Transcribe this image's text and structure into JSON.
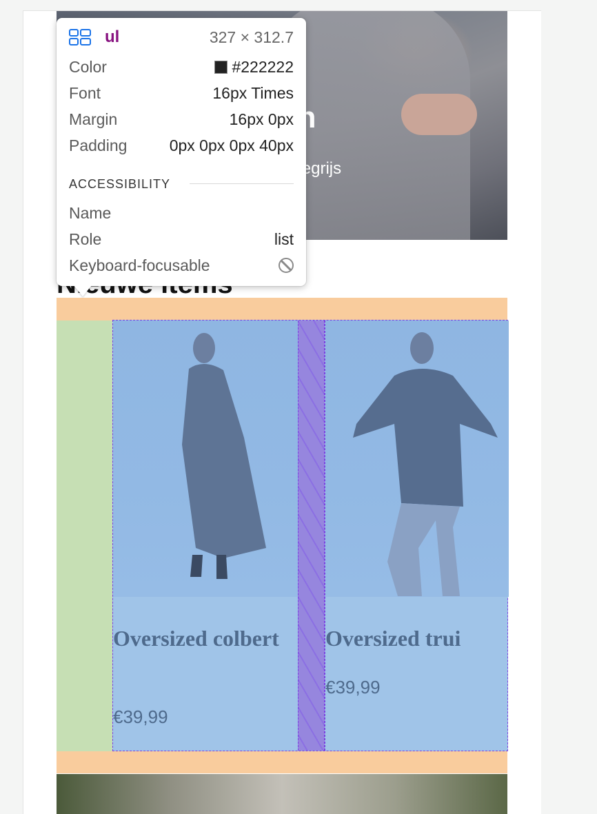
{
  "hero": {
    "title_partial": "jstinten",
    "subtitle_partial": "e tinten heidegrijs\nn steen"
  },
  "section": {
    "title_partial": "Nieuwe items"
  },
  "products": [
    {
      "name": "Oversized colbert",
      "price": "€39,99"
    },
    {
      "name": "Oversized trui",
      "price": "€39,99"
    }
  ],
  "inspector": {
    "tag": "ul",
    "dimensions": "327 × 312.7",
    "rows": [
      {
        "label": "Color",
        "value": "#222222"
      },
      {
        "label": "Font",
        "value": "16px Times"
      },
      {
        "label": "Margin",
        "value": "16px 0px"
      },
      {
        "label": "Padding",
        "value": "0px 0px 0px 40px"
      }
    ],
    "accessibility_title": "ACCESSIBILITY",
    "accessibility": [
      {
        "label": "Name",
        "value": ""
      },
      {
        "label": "Role",
        "value": "list"
      },
      {
        "label": "Keyboard-focusable",
        "value": ""
      }
    ],
    "colors": {
      "tag": "#881280",
      "swatch": "#222222"
    }
  },
  "overlay_colors": {
    "margin": "#f9cc9d",
    "padding": "#c6dfb4",
    "content": "#a0c4e8",
    "gap": "#9686de",
    "outline": "#7b3fe0"
  }
}
